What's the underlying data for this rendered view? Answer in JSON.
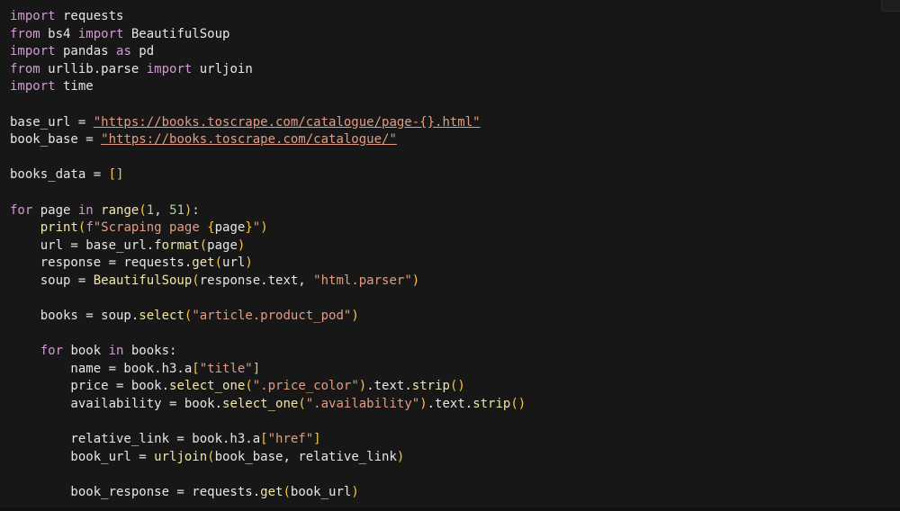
{
  "theme": {
    "background": "#171717",
    "default_text": "#e6e6e6",
    "keyword": "#d19ad4",
    "function": "#f1e7a5",
    "string": "#e39c82",
    "number": "#a9d49c",
    "bracket": "#f6c744"
  },
  "code": {
    "lines": [
      [
        {
          "t": "import",
          "c": "kw"
        },
        {
          "t": " requests",
          "c": "df"
        }
      ],
      [
        {
          "t": "from",
          "c": "kw"
        },
        {
          "t": " bs4 ",
          "c": "df"
        },
        {
          "t": "import",
          "c": "kw"
        },
        {
          "t": " BeautifulSoup",
          "c": "df"
        }
      ],
      [
        {
          "t": "import",
          "c": "kw"
        },
        {
          "t": " pandas ",
          "c": "df"
        },
        {
          "t": "as",
          "c": "kw"
        },
        {
          "t": " pd",
          "c": "df"
        }
      ],
      [
        {
          "t": "from",
          "c": "kw"
        },
        {
          "t": " urllib.parse ",
          "c": "df"
        },
        {
          "t": "import",
          "c": "kw"
        },
        {
          "t": " urljoin",
          "c": "df"
        }
      ],
      [
        {
          "t": "import",
          "c": "kw"
        },
        {
          "t": " time",
          "c": "df"
        }
      ],
      [],
      [
        {
          "t": "base_url = ",
          "c": "df"
        },
        {
          "t": "\"https://books.toscrape.com/catalogue/page-{}.html\"",
          "c": "st url"
        }
      ],
      [
        {
          "t": "book_base = ",
          "c": "df"
        },
        {
          "t": "\"https://books.toscrape.com/catalogue/\"",
          "c": "st url"
        }
      ],
      [],
      [
        {
          "t": "books_data = ",
          "c": "df"
        },
        {
          "t": "[]",
          "c": "br"
        }
      ],
      [],
      [
        {
          "t": "for",
          "c": "kw"
        },
        {
          "t": " page ",
          "c": "df"
        },
        {
          "t": "in",
          "c": "kw"
        },
        {
          "t": " ",
          "c": "df"
        },
        {
          "t": "range",
          "c": "fn"
        },
        {
          "t": "(",
          "c": "br"
        },
        {
          "t": "1",
          "c": "num"
        },
        {
          "t": ", ",
          "c": "df"
        },
        {
          "t": "51",
          "c": "num"
        },
        {
          "t": ")",
          "c": "br"
        },
        {
          "t": ":",
          "c": "df"
        }
      ],
      [
        {
          "t": "    ",
          "c": "df"
        },
        {
          "t": "print",
          "c": "fn"
        },
        {
          "t": "(",
          "c": "br"
        },
        {
          "t": "f",
          "c": "kw"
        },
        {
          "t": "\"Scraping page ",
          "c": "st"
        },
        {
          "t": "{",
          "c": "br"
        },
        {
          "t": "page",
          "c": "df"
        },
        {
          "t": "}",
          "c": "br"
        },
        {
          "t": "\"",
          "c": "st"
        },
        {
          "t": ")",
          "c": "br"
        }
      ],
      [
        {
          "t": "    url = base_url.",
          "c": "df"
        },
        {
          "t": "format",
          "c": "fn"
        },
        {
          "t": "(",
          "c": "br"
        },
        {
          "t": "page",
          "c": "df"
        },
        {
          "t": ")",
          "c": "br"
        }
      ],
      [
        {
          "t": "    response = requests.",
          "c": "df"
        },
        {
          "t": "get",
          "c": "fn"
        },
        {
          "t": "(",
          "c": "br"
        },
        {
          "t": "url",
          "c": "df"
        },
        {
          "t": ")",
          "c": "br"
        }
      ],
      [
        {
          "t": "    soup = ",
          "c": "df"
        },
        {
          "t": "BeautifulSoup",
          "c": "fn"
        },
        {
          "t": "(",
          "c": "br"
        },
        {
          "t": "response.text, ",
          "c": "df"
        },
        {
          "t": "\"html.parser\"",
          "c": "st"
        },
        {
          "t": ")",
          "c": "br"
        }
      ],
      [],
      [
        {
          "t": "    books = soup.",
          "c": "df"
        },
        {
          "t": "select",
          "c": "fn"
        },
        {
          "t": "(",
          "c": "br"
        },
        {
          "t": "\"article.product_pod\"",
          "c": "st"
        },
        {
          "t": ")",
          "c": "br"
        }
      ],
      [],
      [
        {
          "t": "    ",
          "c": "df"
        },
        {
          "t": "for",
          "c": "kw"
        },
        {
          "t": " book ",
          "c": "df"
        },
        {
          "t": "in",
          "c": "kw"
        },
        {
          "t": " books:",
          "c": "df"
        }
      ],
      [
        {
          "t": "        name = book.h3.a",
          "c": "df"
        },
        {
          "t": "[",
          "c": "br"
        },
        {
          "t": "\"title\"",
          "c": "st"
        },
        {
          "t": "]",
          "c": "br"
        }
      ],
      [
        {
          "t": "        price = book.",
          "c": "df"
        },
        {
          "t": "select_one",
          "c": "fn"
        },
        {
          "t": "(",
          "c": "br"
        },
        {
          "t": "\".price_color\"",
          "c": "st"
        },
        {
          "t": ")",
          "c": "br"
        },
        {
          "t": ".text.",
          "c": "df"
        },
        {
          "t": "strip",
          "c": "fn"
        },
        {
          "t": "()",
          "c": "br"
        }
      ],
      [
        {
          "t": "        availability = book.",
          "c": "df"
        },
        {
          "t": "select_one",
          "c": "fn"
        },
        {
          "t": "(",
          "c": "br"
        },
        {
          "t": "\".availability\"",
          "c": "st"
        },
        {
          "t": ")",
          "c": "br"
        },
        {
          "t": ".text.",
          "c": "df"
        },
        {
          "t": "strip",
          "c": "fn"
        },
        {
          "t": "()",
          "c": "br"
        }
      ],
      [],
      [
        {
          "t": "        relative_link = book.h3.a",
          "c": "df"
        },
        {
          "t": "[",
          "c": "br"
        },
        {
          "t": "\"href\"",
          "c": "st"
        },
        {
          "t": "]",
          "c": "br"
        }
      ],
      [
        {
          "t": "        book_url = ",
          "c": "df"
        },
        {
          "t": "urljoin",
          "c": "fn"
        },
        {
          "t": "(",
          "c": "br"
        },
        {
          "t": "book_base, relative_link",
          "c": "df"
        },
        {
          "t": ")",
          "c": "br"
        }
      ],
      [],
      [
        {
          "t": "        book_response = requests.",
          "c": "df"
        },
        {
          "t": "get",
          "c": "fn"
        },
        {
          "t": "(",
          "c": "br"
        },
        {
          "t": "book_url",
          "c": "df"
        },
        {
          "t": ")",
          "c": "br"
        }
      ]
    ]
  }
}
